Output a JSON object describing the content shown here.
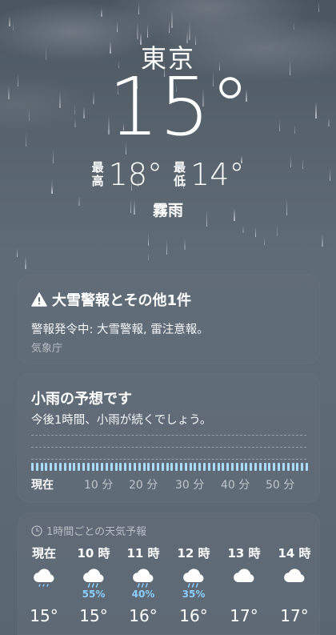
{
  "location": {
    "city": "東京"
  },
  "current": {
    "temperature": "15°",
    "high_label": [
      "最",
      "高"
    ],
    "high": "18°",
    "low_label": [
      "最",
      "低"
    ],
    "low": "14°",
    "condition": "霧雨"
  },
  "alert": {
    "title": "大雪警報とその他1件",
    "text": "警報発令中: 大雪警報, 雷注意報。",
    "source": "気象庁",
    "icon": "warning-triangle-icon"
  },
  "precip": {
    "title": "小雨の予想です",
    "subtitle": "今後1時間、小雨が続くでしょう。",
    "ticks": [
      "現在",
      "10 分",
      "20 分",
      "30 分",
      "40 分",
      "50 分"
    ],
    "bar_color": "#a9dcff",
    "minutes": 60
  },
  "hourly": {
    "header": "1時間ごとの天気予報",
    "icon": "clock-icon",
    "items": [
      {
        "label": "現在",
        "icon": "cloud-drizzle-icon",
        "pop": "",
        "temp": "15°"
      },
      {
        "label": "10 時",
        "icon": "cloud-rain-icon",
        "pop": "55%",
        "temp": "15°"
      },
      {
        "label": "11 時",
        "icon": "cloud-rain-icon",
        "pop": "40%",
        "temp": "16°"
      },
      {
        "label": "12 時",
        "icon": "cloud-rain-icon",
        "pop": "35%",
        "temp": "16°"
      },
      {
        "label": "13 時",
        "icon": "cloud-icon",
        "pop": "",
        "temp": "17°"
      },
      {
        "label": "14 時",
        "icon": "cloud-icon",
        "pop": "",
        "temp": "17°"
      }
    ]
  }
}
